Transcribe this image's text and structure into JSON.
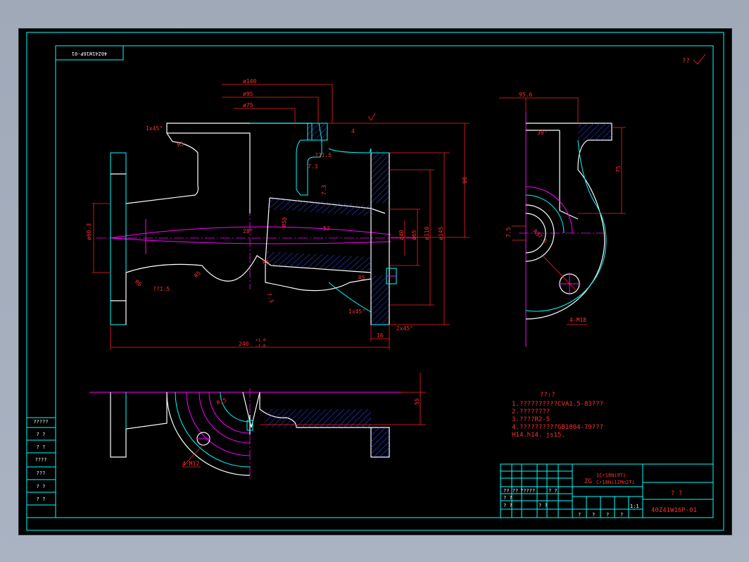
{
  "drawing": {
    "part_code_rotated": "40Z41W16P-01",
    "roughness_note": "??",
    "dimensions": {
      "d140": "ø140",
      "d95": "ø95",
      "d75": "ø75",
      "chamfer1": "1x45°",
      "r5a": "R5",
      "r5b": "R5",
      "r5c": "R5",
      "r5d": "R5",
      "r6": "R6",
      "r21_5a": "??1.5",
      "r21_5b": "??1.5",
      "dim7_3a": "7.3",
      "dim7_3b": "7.3",
      "dim7_3c": "7.3",
      "dim4": "4",
      "dim98": "98",
      "d60_3": "ø60.3",
      "angle28": "28°",
      "d50": "ø50",
      "d52": "52",
      "d40": "ø40",
      "d65": "ø65",
      "d110": "ø110",
      "d145": "ø145",
      "chamfer2": "1x45°",
      "chamfer3": "2x45°",
      "dim16": "16",
      "dim240": "240",
      "tol240_up": "+1.0",
      "tol240_dn": "-1.0",
      "d95_6": "95.6",
      "angle30": "30°",
      "dim75": "75",
      "dim7_5": "7.5",
      "r37_5": "R37.5",
      "m18": "4-M18",
      "r15": "R15",
      "m12": "4-M12",
      "dim55": "55"
    },
    "notes": {
      "title": "??:?",
      "lines": [
        "1.??????????CVA1.5-83???",
        "2.????????",
        "3.????R2-5",
        "4.??????????GB1804-79???",
        "  H14.h14. js15."
      ]
    },
    "left_table": {
      "rows": [
        "?????",
        "? ?",
        "? ?",
        "????",
        "???",
        "? ?",
        "? ?"
      ]
    },
    "title_block": {
      "material_code": "ZG",
      "material_line1": "1Cr18Ni9Ti",
      "material_line2": "Cr18Ni12Mo2Ti",
      "part_name": "? ?",
      "drawing_number": "40Z41W16P-01",
      "scale": "1:1",
      "sheet_mark_1": "?",
      "sheet_mark_2": "?",
      "row_labels": [
        "?? ??",
        "?????",
        "? ?",
        "? ?",
        "? ?",
        "? ?"
      ],
      "bottom_labels": [
        "?",
        "?",
        "?",
        "?"
      ]
    }
  }
}
